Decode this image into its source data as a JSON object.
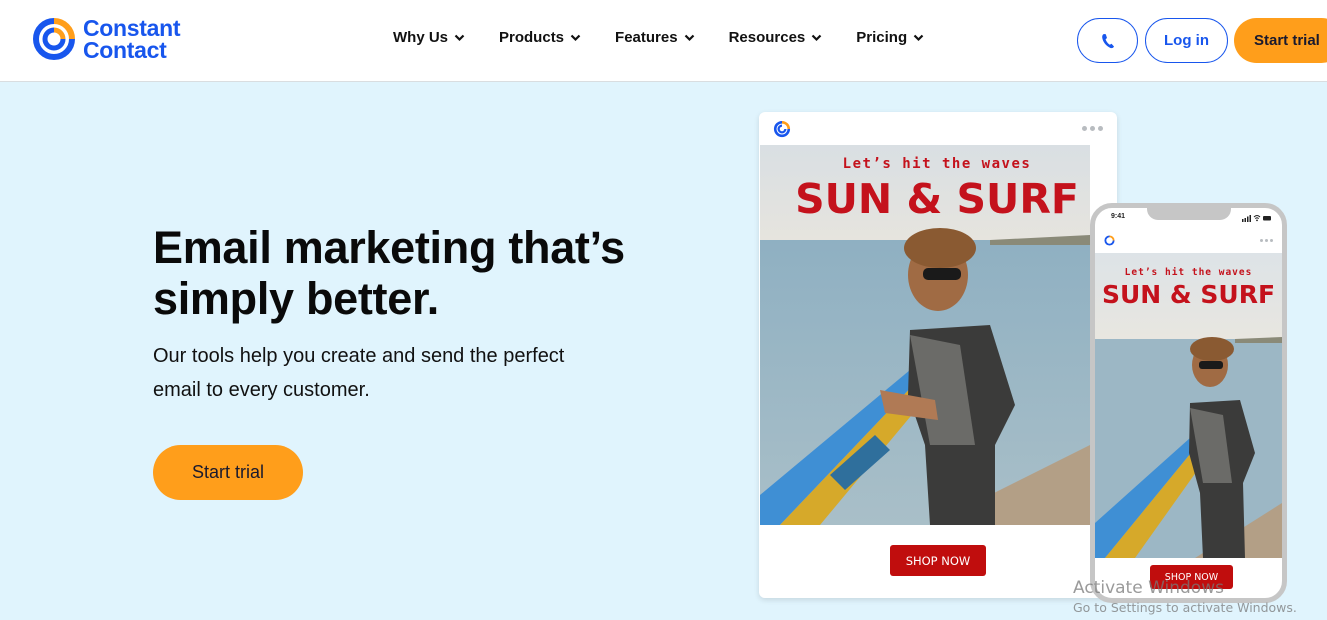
{
  "header": {
    "logo": {
      "line1": "Constant",
      "line2": "Contact",
      "icon": "constant-contact-logo-icon"
    },
    "nav": [
      {
        "label": "Why Us",
        "icon": "chevron-down-icon"
      },
      {
        "label": "Products",
        "icon": "chevron-down-icon"
      },
      {
        "label": "Features",
        "icon": "chevron-down-icon"
      },
      {
        "label": "Resources",
        "icon": "chevron-down-icon"
      },
      {
        "label": "Pricing",
        "icon": "chevron-down-icon"
      }
    ],
    "phone_icon": "phone-icon",
    "login_label": "Log in",
    "start_trial_label": "Start trial"
  },
  "hero": {
    "title_line1": "Email marketing that’s",
    "title_line2": "simply better.",
    "subtitle_line1": "Our tools help you create and send the perfect",
    "subtitle_line2": "email to every customer.",
    "cta_label": "Start trial"
  },
  "preview": {
    "desktop": {
      "kicker": "Let’s hit the waves",
      "headline": "SUN & SURF",
      "cta": "SHOP NOW",
      "menu_icon": "more-horizontal-icon"
    },
    "mobile": {
      "time": "9:41",
      "kicker": "Let’s hit the waves",
      "headline": "SUN & SURF",
      "cta": "SHOP NOW",
      "menu_icon": "more-horizontal-icon"
    }
  },
  "watermark": {
    "line1": "Activate Windows",
    "line2": "Go to Settings to activate Windows."
  },
  "colors": {
    "brand_blue": "#1856ed",
    "brand_orange": "#ff9e1b",
    "hero_bg": "#e0f4fd",
    "promo_red": "#c00d0d"
  }
}
